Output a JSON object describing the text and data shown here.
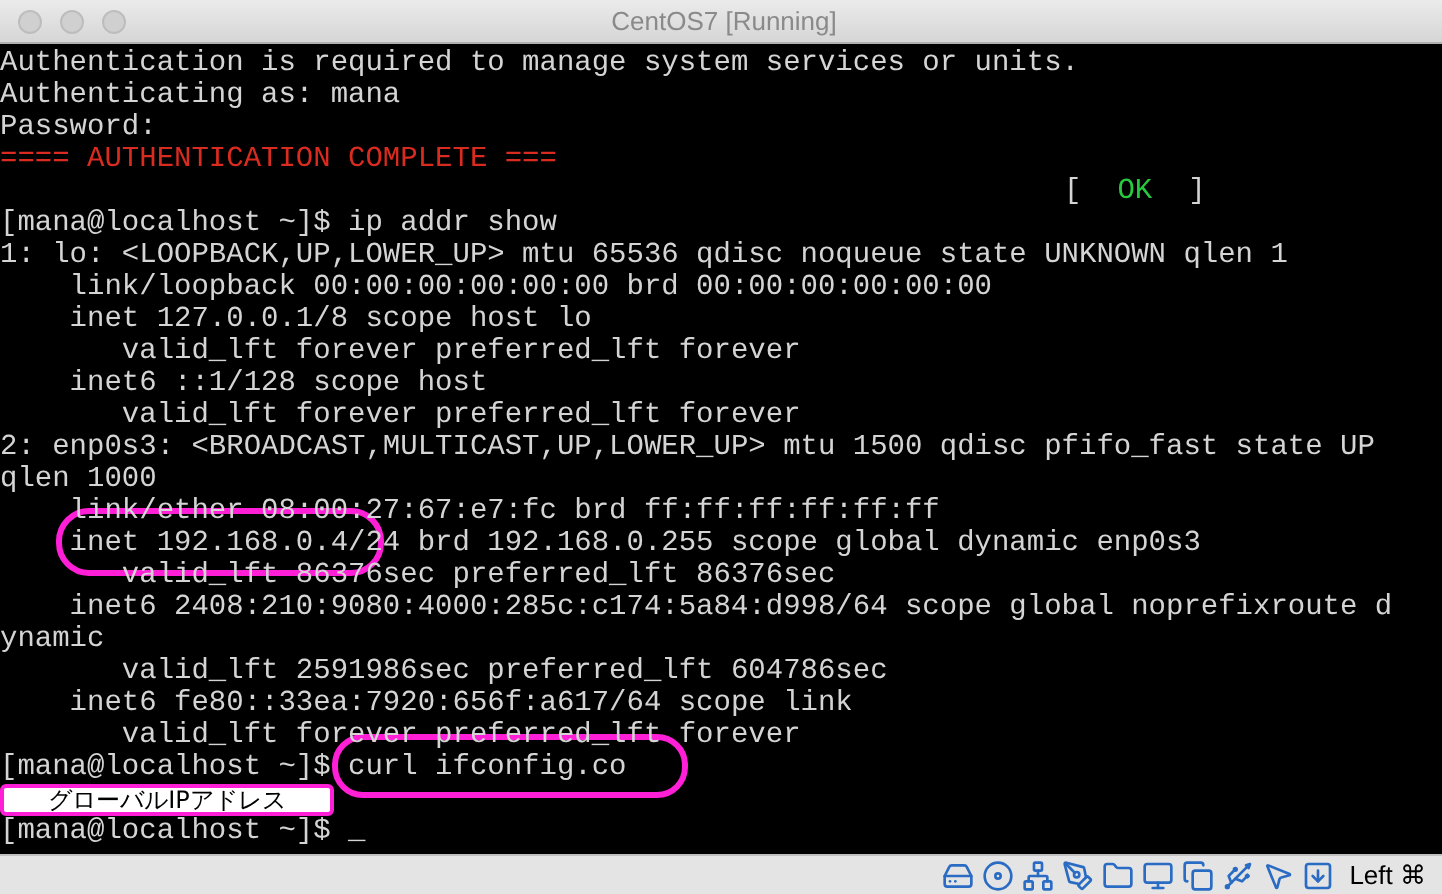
{
  "window": {
    "title": "CentOS7 [Running]"
  },
  "terminal": {
    "lines": [
      {
        "kind": "text",
        "text": "Authentication is required to manage system services or units."
      },
      {
        "kind": "text",
        "text": "Authenticating as: mana"
      },
      {
        "kind": "text",
        "text": "Password:"
      },
      {
        "kind": "alert",
        "text": "==== AUTHENTICATION COMPLETE ==="
      },
      {
        "kind": "status",
        "open": "[",
        "text": "OK",
        "close": "]"
      },
      {
        "kind": "text",
        "text": "[mana@localhost ~]$ ip addr show"
      },
      {
        "kind": "text",
        "text": "1: lo: <LOOPBACK,UP,LOWER_UP> mtu 65536 qdisc noqueue state UNKNOWN qlen 1"
      },
      {
        "kind": "text",
        "text": "    link/loopback 00:00:00:00:00:00 brd 00:00:00:00:00:00"
      },
      {
        "kind": "text",
        "text": "    inet 127.0.0.1/8 scope host lo"
      },
      {
        "kind": "text",
        "text": "       valid_lft forever preferred_lft forever"
      },
      {
        "kind": "text",
        "text": "    inet6 ::1/128 scope host"
      },
      {
        "kind": "text",
        "text": "       valid_lft forever preferred_lft forever"
      },
      {
        "kind": "text",
        "text": "2: enp0s3: <BROADCAST,MULTICAST,UP,LOWER_UP> mtu 1500 qdisc pfifo_fast state UP"
      },
      {
        "kind": "text",
        "text": "qlen 1000"
      },
      {
        "kind": "text",
        "text": "    link/ether 08:00:27:67:e7:fc brd ff:ff:ff:ff:ff:ff"
      },
      {
        "kind": "text",
        "text": "    inet 192.168.0.4/24 brd 192.168.0.255 scope global dynamic enp0s3"
      },
      {
        "kind": "text",
        "text": "       valid_lft 86376sec preferred_lft 86376sec"
      },
      {
        "kind": "text",
        "text": "    inet6 2408:210:9080:4000:285c:c174:5a84:d998/64 scope global noprefixroute d"
      },
      {
        "kind": "text",
        "text": "ynamic"
      },
      {
        "kind": "text",
        "text": "       valid_lft 2591986sec preferred_lft 604786sec"
      },
      {
        "kind": "text",
        "text": "    inet6 fe80::33ea:7920:656f:a617/64 scope link"
      },
      {
        "kind": "text",
        "text": "       valid_lft forever preferred_lft forever"
      },
      {
        "kind": "text",
        "text": "[mana@localhost ~]$ curl ifconfig.co"
      },
      {
        "kind": "blank"
      },
      {
        "kind": "text",
        "text": "[mana@localhost ~]$ _"
      }
    ]
  },
  "annotation": {
    "label": "グローバルIPアドレス"
  },
  "status_bar": {
    "host_key": "Left ⌘"
  }
}
